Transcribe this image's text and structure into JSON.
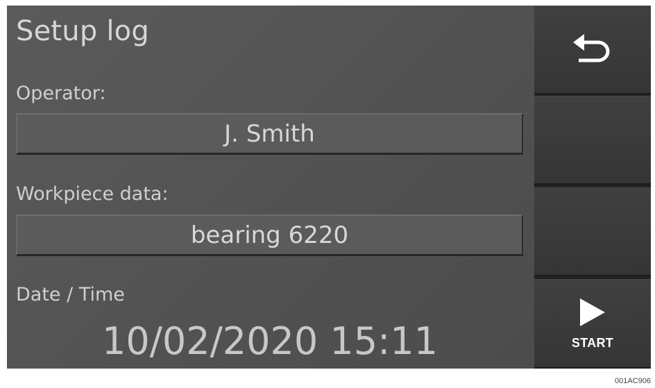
{
  "header": {
    "title": "Setup log"
  },
  "form": {
    "operator_label": "Operator:",
    "operator_value": "J. Smith",
    "workpiece_label": "Workpiece data:",
    "workpiece_value": "bearing 6220",
    "datetime_label": "Date / Time",
    "datetime_value": "10/02/2020 15:11"
  },
  "sidebar": {
    "back_icon": "back-arrow-icon",
    "start_icon": "play-icon",
    "start_label": "START"
  },
  "figure": {
    "code": "001AC906"
  },
  "colors": {
    "screen_bg": "#555555",
    "sidebar_button_bg": "#3a3a3a",
    "text_light": "#d6d6d6"
  }
}
